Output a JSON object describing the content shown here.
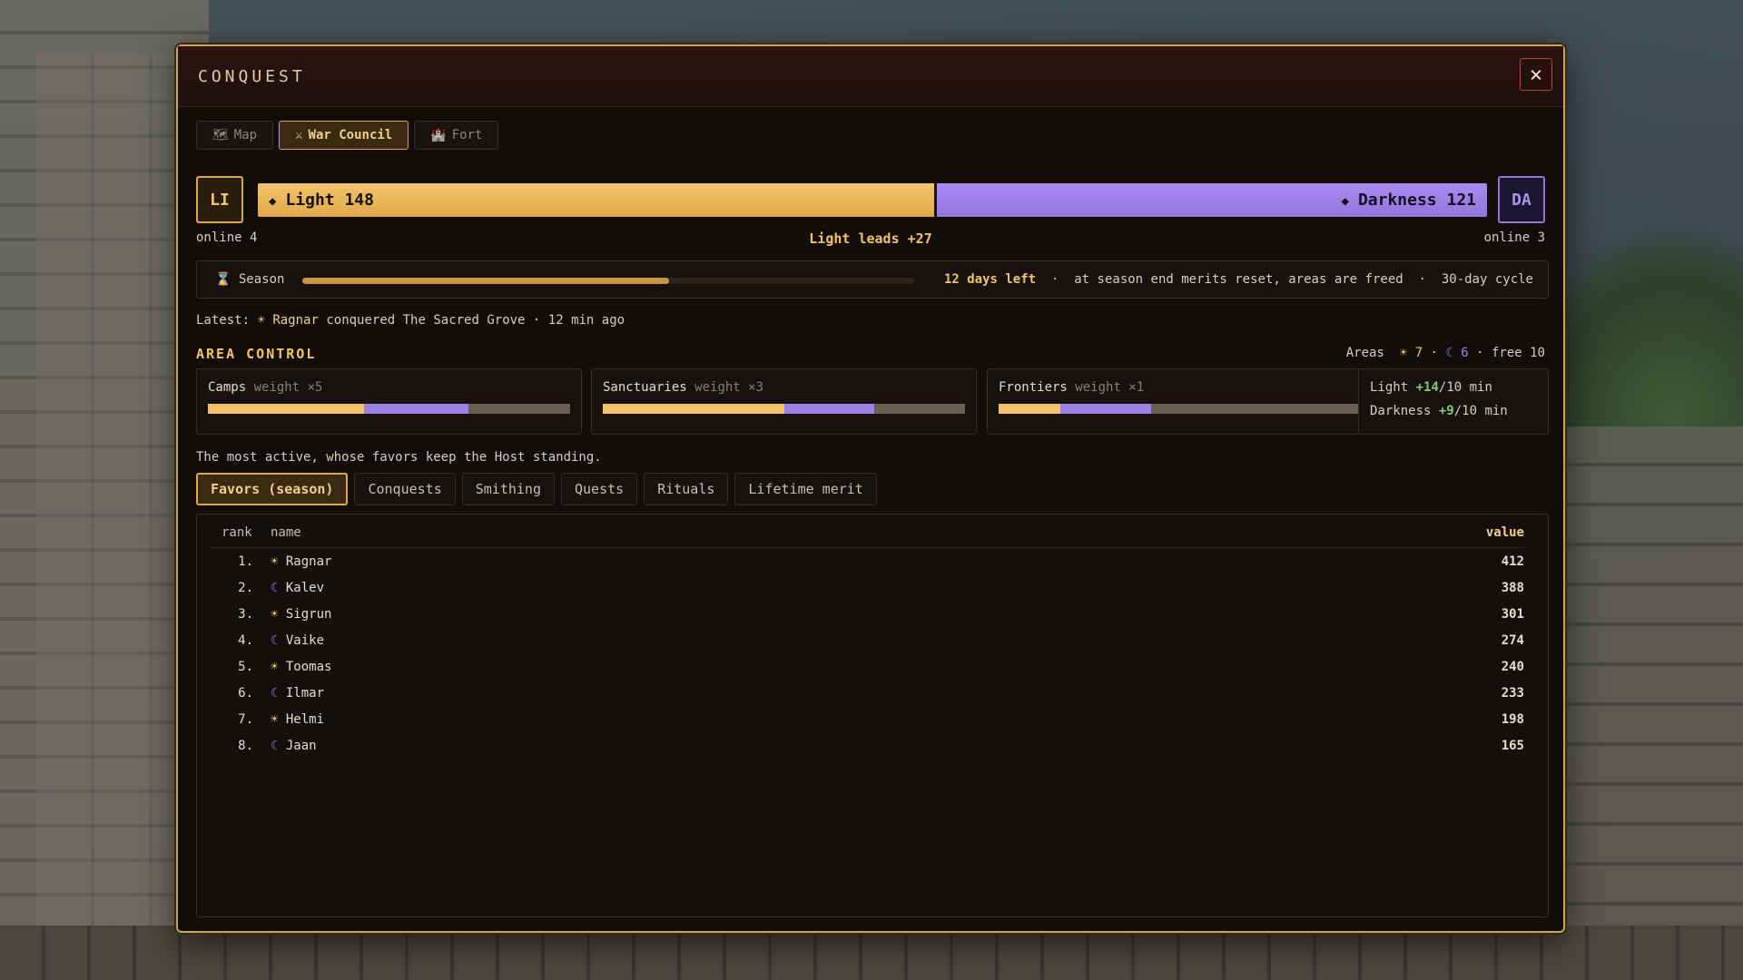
{
  "modal": {
    "title": "CONQUEST",
    "close_icon": "close-icon"
  },
  "tabs": [
    {
      "icon": "map-icon",
      "glyph": "🗺",
      "label": "Map",
      "active": false
    },
    {
      "icon": "crossed-swords-icon",
      "glyph": "⚔",
      "label": "War Council",
      "active": true
    },
    {
      "icon": "castle-icon",
      "glyph": "🏰",
      "label": "Fort",
      "active": false
    }
  ],
  "factions": {
    "light": {
      "badge": "LI",
      "label": "Light 148",
      "score": 148,
      "online": "online 4",
      "color": "#f2c36a"
    },
    "darkness": {
      "badge": "DA",
      "label": "Darkness 121",
      "score": 121,
      "online": "online 3",
      "color": "#9d82e6"
    },
    "lead_text": "Light leads +27"
  },
  "season": {
    "label": "Season",
    "progress": 0.6,
    "days_left": "12 days left",
    "separator": "·",
    "note": "at season end merits reset, areas are freed",
    "cycle": "30-day cycle"
  },
  "latest": {
    "prefix": "Latest:",
    "player": "Ragnar",
    "faction": "light",
    "text": "conquered The Sacred Grove · 12 min ago"
  },
  "area_control": {
    "title": "AREA CONTROL",
    "summary_label": "Areas",
    "light_count": "7",
    "dark_count": "6",
    "free": "free 10",
    "areas": [
      {
        "name": "Camps",
        "weight": "weight ×5",
        "light": 0.43,
        "dark": 0.29
      },
      {
        "name": "Sanctuaries",
        "weight": "weight ×3",
        "light": 0.5,
        "dark": 0.25
      },
      {
        "name": "Frontiers",
        "weight": "weight ×1",
        "light": 0.17,
        "dark": 0.25
      }
    ],
    "rates": {
      "light_label": "Light",
      "light_rate": "+14",
      "light_unit": "/10 min",
      "dark_label": "Darkness",
      "dark_rate": "+9",
      "dark_unit": "/10 min"
    }
  },
  "leaderboard": {
    "description": "The most active, whose favors keep the Host standing.",
    "tabs": [
      "Favors (season)",
      "Conquests",
      "Smithing",
      "Quests",
      "Rituals",
      "Lifetime merit"
    ],
    "active_tab": 0,
    "columns": {
      "rank": "rank",
      "name": "name",
      "value": "value"
    },
    "rows": [
      {
        "rank": "1.",
        "name": "Ragnar",
        "faction": "light",
        "value": "412"
      },
      {
        "rank": "2.",
        "name": "Kalev",
        "faction": "dark",
        "value": "388"
      },
      {
        "rank": "3.",
        "name": "Sigrun",
        "faction": "light",
        "value": "301"
      },
      {
        "rank": "4.",
        "name": "Vaike",
        "faction": "dark",
        "value": "274"
      },
      {
        "rank": "5.",
        "name": "Toomas",
        "faction": "light",
        "value": "240"
      },
      {
        "rank": "6.",
        "name": "Ilmar",
        "faction": "dark",
        "value": "233"
      },
      {
        "rank": "7.",
        "name": "Helmi",
        "faction": "light",
        "value": "198"
      },
      {
        "rank": "8.",
        "name": "Jaan",
        "faction": "dark",
        "value": "165"
      }
    ]
  }
}
